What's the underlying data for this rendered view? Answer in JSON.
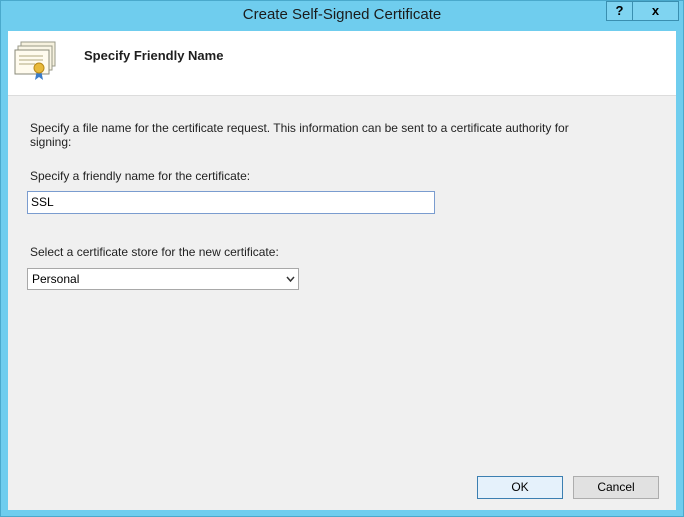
{
  "window": {
    "title": "Create Self-Signed Certificate",
    "help_label": "?",
    "close_label": "x"
  },
  "header": {
    "title": "Specify Friendly Name",
    "icon": "certificate-icon"
  },
  "content": {
    "description": "Specify a file name for the certificate request.  This information can be sent to a certificate authority for signing:",
    "friendly_name_label": "Specify a friendly name for the certificate:",
    "friendly_name_value": "SSL",
    "store_label": "Select a certificate store for the new certificate:",
    "store_value": "Personal"
  },
  "buttons": {
    "ok": "OK",
    "cancel": "Cancel"
  },
  "colors": {
    "titlebar": "#6fcdee",
    "client": "#f0f0f0",
    "accent": "#3c7fb1"
  }
}
